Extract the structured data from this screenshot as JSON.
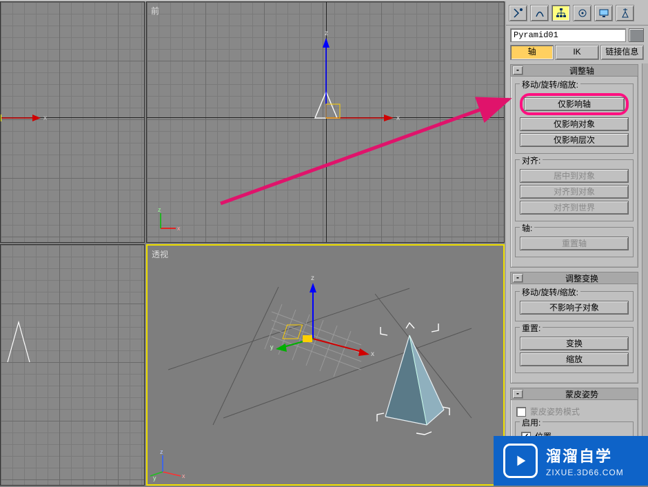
{
  "viewports": {
    "front_label": "前",
    "perspective_label": "透视"
  },
  "panel": {
    "object_name": "Pyramid01",
    "cat": {
      "axis": "轴",
      "ik": "IK",
      "link_info": "链接信息"
    }
  },
  "rollup_adjust_pivot": {
    "title": "调整轴",
    "group_move": {
      "title": "移动/旋转/缩放:",
      "affect_pivot_only": "仅影响轴",
      "affect_object_only": "仅影响对象",
      "affect_hierarchy_only": "仅影响层次"
    },
    "group_align": {
      "title": "对齐:",
      "center_to_object": "居中到对象",
      "align_to_object": "对齐到对象",
      "align_to_world": "对齐到世界"
    },
    "group_axis": {
      "title": "轴:",
      "reset_axis": "重置轴"
    }
  },
  "rollup_adjust_transform": {
    "title": "调整变换",
    "group_move": {
      "title": "移动/旋转/缩放:",
      "dont_affect_children": "不影响子对象"
    },
    "group_reset": {
      "title": "重置:",
      "transform": "变换",
      "scale": "缩放"
    }
  },
  "rollup_skin_pose": {
    "title": "蒙皮姿势",
    "skin_pose_mode": "蒙皮姿势模式",
    "group_enable": {
      "title": "启用:",
      "position": "位置"
    }
  },
  "watermark": {
    "line1": "溜溜自学",
    "line2": "ZIXUE.3D66.COM"
  },
  "axis_labels": {
    "x": "x",
    "y": "y",
    "z": "z"
  }
}
